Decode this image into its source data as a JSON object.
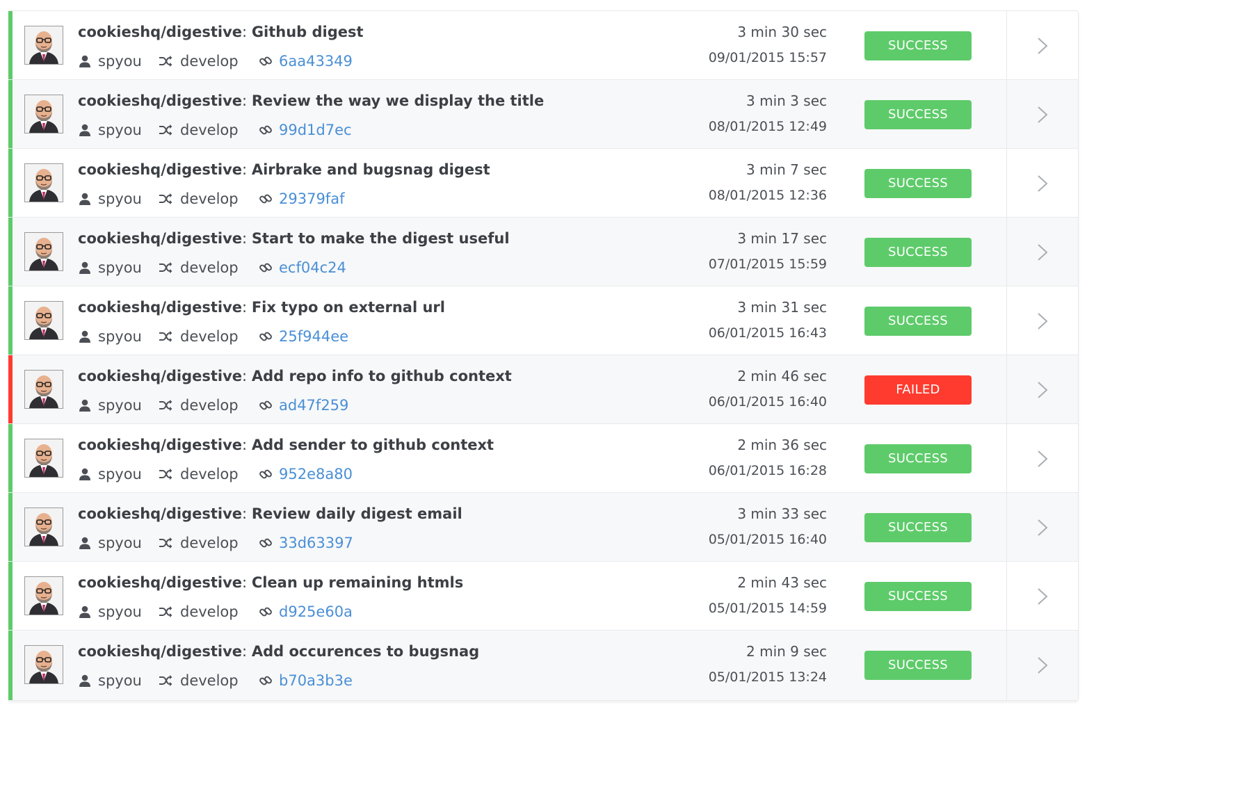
{
  "colors": {
    "success": "#5ecb6a",
    "failed": "#ff3b30",
    "link": "#4a8fd6",
    "text": "#3c3f44"
  },
  "builds": [
    {
      "repo": "cookieshq/digestive",
      "message": "Github digest",
      "user": "spyou",
      "branch": "develop",
      "commit": "6aa43349",
      "duration": "3 min 30 sec",
      "date": "09/01/2015 15:57",
      "status": "SUCCESS"
    },
    {
      "repo": "cookieshq/digestive",
      "message": "Review the way we display the title",
      "user": "spyou",
      "branch": "develop",
      "commit": "99d1d7ec",
      "duration": "3 min 3 sec",
      "date": "08/01/2015 12:49",
      "status": "SUCCESS"
    },
    {
      "repo": "cookieshq/digestive",
      "message": "Airbrake and bugsnag digest",
      "user": "spyou",
      "branch": "develop",
      "commit": "29379faf",
      "duration": "3 min 7 sec",
      "date": "08/01/2015 12:36",
      "status": "SUCCESS"
    },
    {
      "repo": "cookieshq/digestive",
      "message": "Start to make the digest useful",
      "user": "spyou",
      "branch": "develop",
      "commit": "ecf04c24",
      "duration": "3 min 17 sec",
      "date": "07/01/2015 15:59",
      "status": "SUCCESS"
    },
    {
      "repo": "cookieshq/digestive",
      "message": "Fix typo on external url",
      "user": "spyou",
      "branch": "develop",
      "commit": "25f944ee",
      "duration": "3 min 31 sec",
      "date": "06/01/2015 16:43",
      "status": "SUCCESS"
    },
    {
      "repo": "cookieshq/digestive",
      "message": "Add repo info to github context",
      "user": "spyou",
      "branch": "develop",
      "commit": "ad47f259",
      "duration": "2 min 46 sec",
      "date": "06/01/2015 16:40",
      "status": "FAILED"
    },
    {
      "repo": "cookieshq/digestive",
      "message": "Add sender to github context",
      "user": "spyou",
      "branch": "develop",
      "commit": "952e8a80",
      "duration": "2 min 36 sec",
      "date": "06/01/2015 16:28",
      "status": "SUCCESS"
    },
    {
      "repo": "cookieshq/digestive",
      "message": "Review daily digest email",
      "user": "spyou",
      "branch": "develop",
      "commit": "33d63397",
      "duration": "3 min 33 sec",
      "date": "05/01/2015 16:40",
      "status": "SUCCESS"
    },
    {
      "repo": "cookieshq/digestive",
      "message": "Clean up remaining htmls",
      "user": "spyou",
      "branch": "develop",
      "commit": "d925e60a",
      "duration": "2 min 43 sec",
      "date": "05/01/2015 14:59",
      "status": "SUCCESS"
    },
    {
      "repo": "cookieshq/digestive",
      "message": "Add occurences to bugsnag",
      "user": "spyou",
      "branch": "develop",
      "commit": "b70a3b3e",
      "duration": "2 min 9 sec",
      "date": "05/01/2015 13:24",
      "status": "SUCCESS"
    }
  ]
}
